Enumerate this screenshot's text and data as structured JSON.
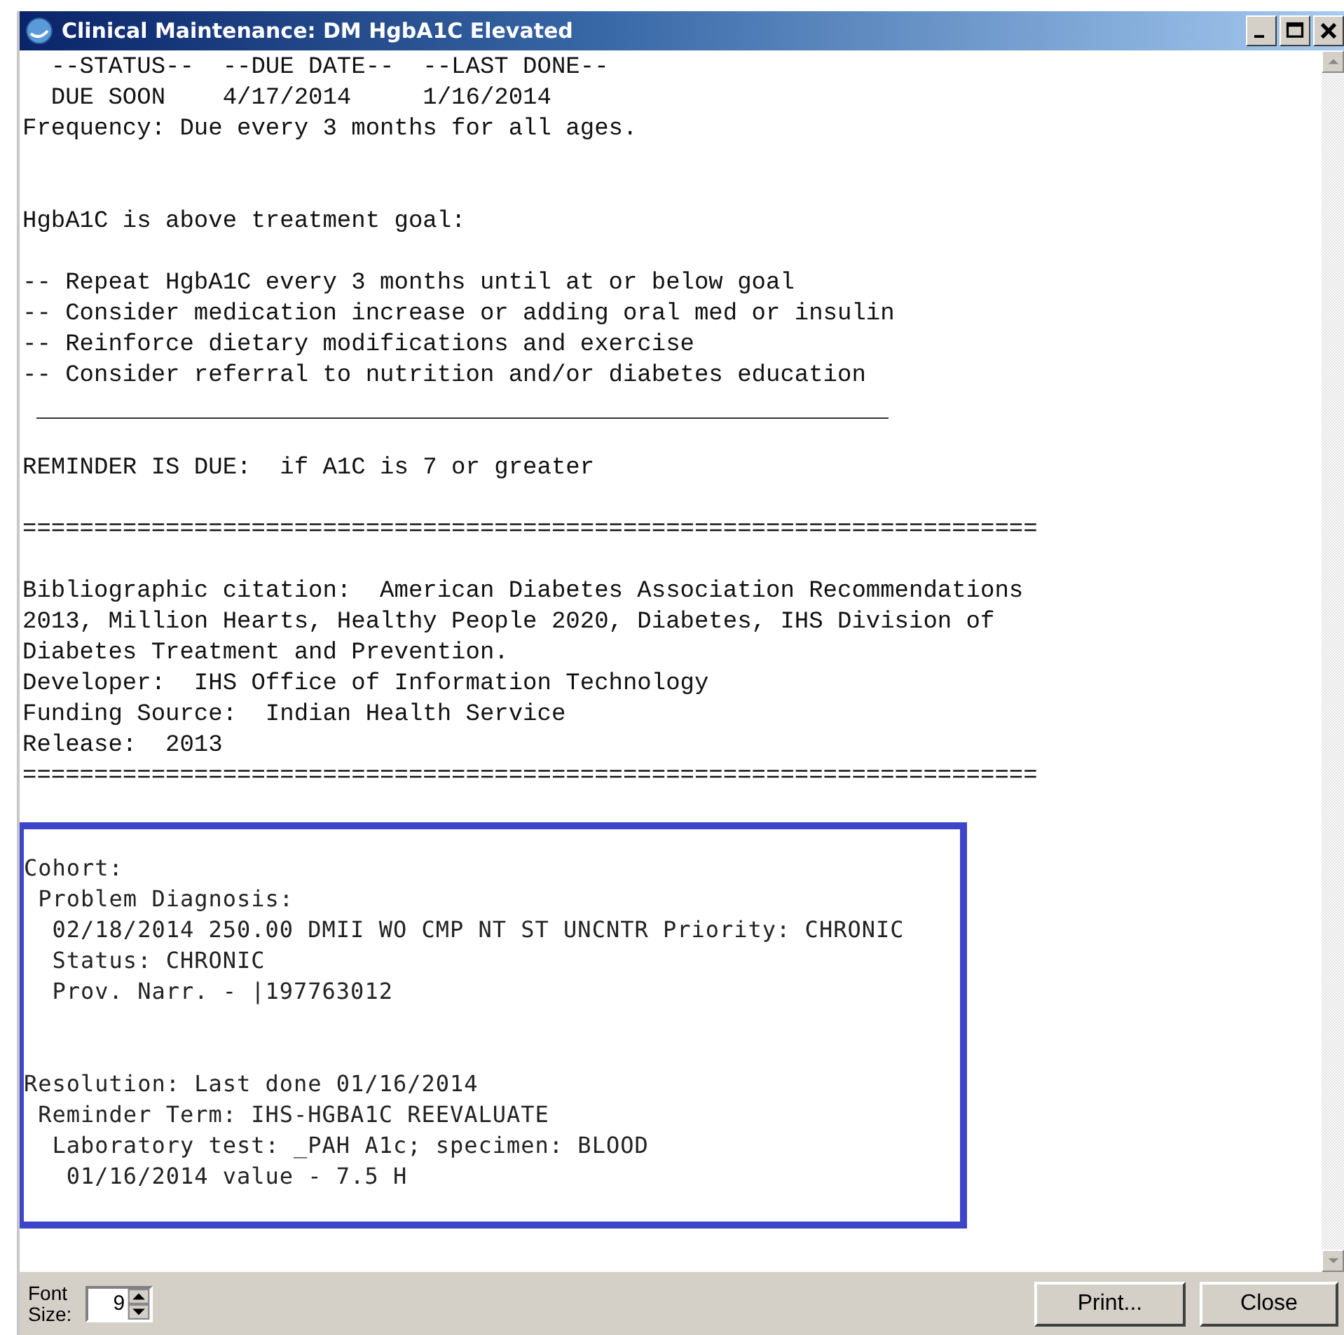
{
  "window": {
    "title": "Clinical Maintenance: DM HgbA1C Elevated"
  },
  "report": [
    {
      "kind": "text",
      "lines": [
        "  --STATUS--  --DUE DATE--  --LAST DONE--",
        "  DUE SOON    4/17/2014     1/16/2014",
        "Frequency: Due every 3 months for all ages."
      ]
    },
    {
      "kind": "blank"
    },
    {
      "kind": "blank"
    },
    {
      "kind": "text",
      "lines": [
        "HgbA1C is above treatment goal:"
      ]
    },
    {
      "kind": "blank"
    },
    {
      "kind": "text",
      "lines": [
        "-- Repeat HgbA1C every 3 months until at or below goal",
        "-- Consider medication increase or adding oral med or insulin",
        "-- Reinforce dietary modifications and exercise",
        "-- Consider referral to nutrition and/or diabetes education"
      ]
    },
    {
      "kind": "rule"
    },
    {
      "kind": "blank"
    },
    {
      "kind": "text",
      "lines": [
        "REMINDER IS DUE:  if A1C is 7 or greater"
      ]
    },
    {
      "kind": "blank"
    },
    {
      "kind": "text",
      "lines": [
        "======================================================================="
      ]
    },
    {
      "kind": "blank"
    },
    {
      "kind": "text",
      "lines": [
        "Bibliographic citation:  American Diabetes Association Recommendations",
        "2013, Million Hearts, Healthy People 2020, Diabetes, IHS Division of",
        "Diabetes Treatment and Prevention.",
        "Developer:  IHS Office of Information Technology",
        "Funding Source:  Indian Health Service",
        "Release:  2013",
        "======================================================================="
      ]
    }
  ],
  "highlight_box": [
    {
      "kind": "text",
      "lines": [
        "Cohort:",
        " Problem Diagnosis:",
        "  02/18/2014 250.00 DMII WO CMP NT ST UNCNTR Priority: CHRONIC",
        "  Status: CHRONIC",
        "  Prov. Narr. - |197763012"
      ]
    },
    {
      "kind": "blank"
    },
    {
      "kind": "blank"
    },
    {
      "kind": "text",
      "lines": [
        "Resolution: Last done 01/16/2014",
        " Reminder Term: IHS-HGBA1C REEVALUATE",
        "  Laboratory test: _PAH A1c; specimen: BLOOD",
        "   01/16/2014 value - 7.5 H"
      ]
    }
  ],
  "footer": {
    "font_size_label": "Font\nSize:",
    "font_size_value": "9",
    "buttons": [
      "Print...",
      "Close"
    ]
  }
}
